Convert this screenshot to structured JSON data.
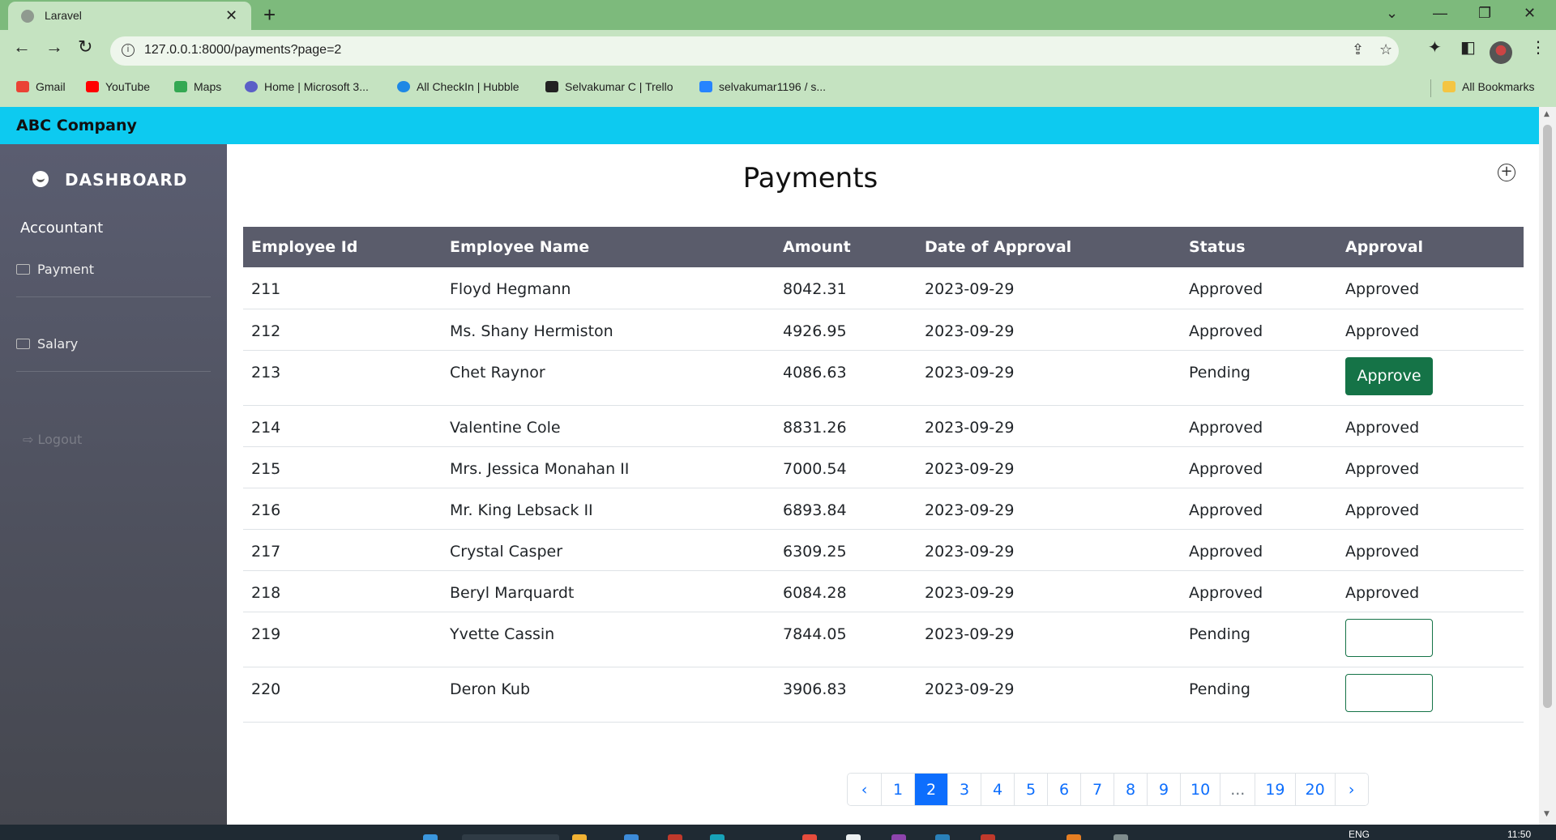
{
  "browser": {
    "tab_title": "Laravel",
    "url": "127.0.0.1:8000/payments?page=2",
    "bookmarks": [
      {
        "label": "Gmail",
        "color": "#ea4335"
      },
      {
        "label": "YouTube",
        "color": "#ff0000"
      },
      {
        "label": "Maps",
        "color": "#34a853"
      },
      {
        "label": "Home | Microsoft 3...",
        "color": "#5b5fc7"
      },
      {
        "label": "All CheckIn | Hubble",
        "color": "#1e88e5"
      },
      {
        "label": "Selvakumar C | Trello",
        "color": "#222222"
      },
      {
        "label": "selvakumar1196 / s...",
        "color": "#2684ff"
      }
    ],
    "all_bookmarks": "All Bookmarks"
  },
  "app": {
    "brand": "ABC Company",
    "accent_color": "#0dcaf0"
  },
  "sidebar": {
    "dashboard": "DASHBOARD",
    "role": "Accountant",
    "payment": "Payment",
    "salary": "Salary",
    "logout": "Logout"
  },
  "main": {
    "title": "Payments",
    "columns": [
      "Employee Id",
      "Employee Name",
      "Amount",
      "Date of Approval",
      "Status",
      "Approval"
    ],
    "rows": [
      {
        "id": "211",
        "name": "Floyd Hegmann",
        "amount": "8042.31",
        "date": "2023-09-29",
        "status": "Approved",
        "approval": "Approved"
      },
      {
        "id": "212",
        "name": "Ms. Shany Hermiston",
        "amount": "4926.95",
        "date": "2023-09-29",
        "status": "Approved",
        "approval": "Approved"
      },
      {
        "id": "213",
        "name": "Chet Raynor",
        "amount": "4086.63",
        "date": "2023-09-29",
        "status": "Pending",
        "approval": "Approve"
      },
      {
        "id": "214",
        "name": "Valentine Cole",
        "amount": "8831.26",
        "date": "2023-09-29",
        "status": "Approved",
        "approval": "Approved"
      },
      {
        "id": "215",
        "name": "Mrs. Jessica Monahan II",
        "amount": "7000.54",
        "date": "2023-09-29",
        "status": "Approved",
        "approval": "Approved"
      },
      {
        "id": "216",
        "name": "Mr. King Lebsack II",
        "amount": "6893.84",
        "date": "2023-09-29",
        "status": "Approved",
        "approval": "Approved"
      },
      {
        "id": "217",
        "name": "Crystal Casper",
        "amount": "6309.25",
        "date": "2023-09-29",
        "status": "Approved",
        "approval": "Approved"
      },
      {
        "id": "218",
        "name": "Beryl Marquardt",
        "amount": "6084.28",
        "date": "2023-09-29",
        "status": "Approved",
        "approval": "Approved"
      },
      {
        "id": "219",
        "name": "Yvette Cassin",
        "amount": "7844.05",
        "date": "2023-09-29",
        "status": "Pending",
        "approval": ""
      },
      {
        "id": "220",
        "name": "Deron Kub",
        "amount": "3906.83",
        "date": "2023-09-29",
        "status": "Pending",
        "approval": ""
      }
    ],
    "pagination": [
      "‹",
      "1",
      "2",
      "3",
      "4",
      "5",
      "6",
      "7",
      "8",
      "9",
      "10",
      "...",
      "19",
      "20",
      "›"
    ],
    "current_page": "2"
  },
  "taskbar": {
    "lang": "ENG",
    "time": "11:50"
  }
}
